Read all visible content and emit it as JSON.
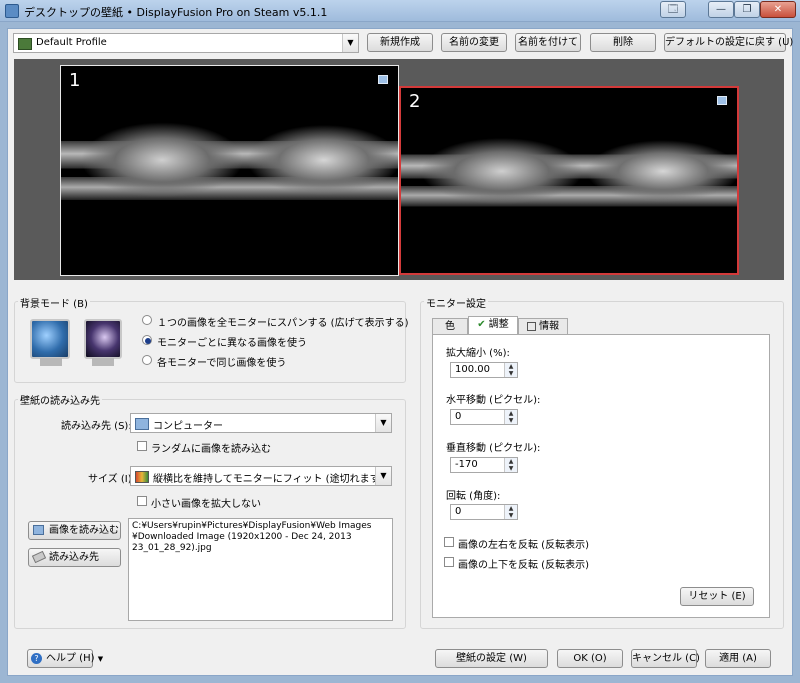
{
  "window": {
    "title": "デスクトップの壁紙 • DisplayFusion Pro on Steam v5.1.1",
    "controls": [
      "🗔",
      "—",
      "❐",
      "✕"
    ]
  },
  "toolbar": {
    "profile_value": "Default Profile",
    "new_label": "新規作成",
    "rename_label": "名前の変更",
    "save_as_label": "名前を付けて",
    "delete_label": "削除",
    "reset_defaults_label": "デフォルトの設定に戻す (U)"
  },
  "preview": {
    "monitor1_number": "1",
    "monitor2_number": "2"
  },
  "background_mode": {
    "group_label": "背景モード (B)",
    "options": [
      "１つの画像を全モニターにスパンする (広げて表示する)",
      "モニターごとに異なる画像を使う",
      "各モニターで同じ画像を使う"
    ],
    "selected_index": 1
  },
  "wallpaper_load": {
    "group_label": "壁紙の読み込み先",
    "source_label": "読み込み先 (S):",
    "source_value": "コンピューター",
    "random_label": "ランダムに画像を読み込む",
    "size_label": "サイズ (I):",
    "size_value": "縦横比を維持してモニターにフィット (途切れます)",
    "no_enlarge_label": "小さい画像を拡大しない",
    "load_image_button": "画像を読み込む",
    "load_source_button": "読み込み先",
    "file_path": "C:¥Users¥rupin¥Pictures¥DisplayFusion¥Web Images\n¥Downloaded Image (1920x1200 - Dec 24, 2013\n23_01_28_92).jpg"
  },
  "monitor_settings": {
    "group_label": "モニター設定",
    "tabs": [
      "色",
      "調整",
      "情報"
    ],
    "active_tab": 1,
    "scale_label": "拡大縮小 (%):",
    "scale_value": "100.00",
    "h_offset_label": "水平移動 (ピクセル):",
    "h_offset_value": "0",
    "v_offset_label": "垂直移動 (ピクセル):",
    "v_offset_value": "-170",
    "rotation_label": "回転 (角度):",
    "rotation_value": "0",
    "flip_h_label": "画像の左右を反転 (反転表示)",
    "flip_v_label": "画像の上下を反転 (反転表示)",
    "reset_label": "リセット (E)"
  },
  "footer": {
    "help_label": "ヘルプ (H)",
    "wallpaper_settings_label": "壁紙の設定 (W)",
    "ok_label": "OK (O)",
    "cancel_label": "キャンセル (C)",
    "apply_label": "適用 (A)"
  },
  "colors": {
    "preview_bg": "#5a5a5a",
    "selected_monitor_border": "#d33a3a"
  }
}
